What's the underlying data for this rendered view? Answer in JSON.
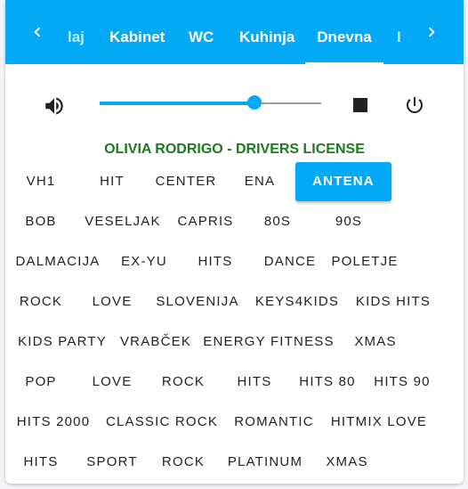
{
  "tabs": {
    "items": [
      "laj",
      "Kabinet",
      "WC",
      "Kuhinja",
      "Dnevna",
      "I"
    ],
    "active": "Dnevna"
  },
  "player": {
    "volume_percent": 70,
    "now_playing": "OLIVIA RODRIGO - DRIVERS LICENSE"
  },
  "icons": {
    "prev": "chevron-left-icon",
    "next": "chevron-right-icon",
    "volume": "volume-icon",
    "stop": "stop-icon",
    "power": "power-icon"
  },
  "colors": {
    "accent": "#03a9f4",
    "now_playing": "#1b7a1b"
  },
  "stations": [
    [
      "VH1",
      "HIT",
      "CENTER",
      "ENA",
      "ANTENA"
    ],
    [
      "BOB",
      "VESELJAK",
      "CAPRIS",
      "80S",
      "90S"
    ],
    [
      "DALMACIJA",
      "EX-YU",
      "HITS",
      "DANCE",
      "POLETJE"
    ],
    [
      "ROCK",
      "LOVE",
      "SLOVENIJA",
      "KEYS4KIDS",
      "KIDS HITS"
    ],
    [
      "KIDS PARTY",
      "VRABČEK",
      "ENERGY FITNESS",
      "XMAS"
    ],
    [
      "POP",
      "LOVE",
      "ROCK",
      "HITS",
      "HITS 80",
      "HITS 90"
    ],
    [
      "HITS 2000",
      "CLASSIC ROCK",
      "ROMANTIC",
      "HITMIX LOVE"
    ],
    [
      "HITS",
      "SPORT",
      "ROCK",
      "PLATINUM",
      "XMAS"
    ]
  ],
  "active_station": "ANTENA"
}
